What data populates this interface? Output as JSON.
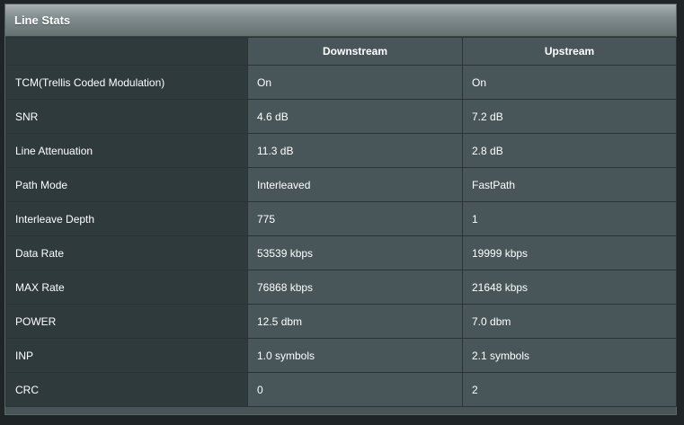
{
  "panel": {
    "title": "Line Stats"
  },
  "table": {
    "columns": [
      "",
      "Downstream",
      "Upstream"
    ],
    "rows": [
      {
        "label": "TCM(Trellis Coded Modulation)",
        "downstream": "On",
        "upstream": "On"
      },
      {
        "label": "SNR",
        "downstream": "4.6 dB",
        "upstream": "7.2 dB"
      },
      {
        "label": "Line Attenuation",
        "downstream": "11.3 dB",
        "upstream": "2.8 dB"
      },
      {
        "label": "Path Mode",
        "downstream": "Interleaved",
        "upstream": "FastPath"
      },
      {
        "label": "Interleave Depth",
        "downstream": "775",
        "upstream": "1"
      },
      {
        "label": "Data Rate",
        "downstream": "53539 kbps",
        "upstream": "19999 kbps"
      },
      {
        "label": "MAX Rate",
        "downstream": "76868 kbps",
        "upstream": "21648 kbps"
      },
      {
        "label": "POWER",
        "downstream": "12.5 dbm",
        "upstream": "7.0 dbm"
      },
      {
        "label": "INP",
        "downstream": "1.0 symbols",
        "upstream": "2.1 symbols"
      },
      {
        "label": "CRC",
        "downstream": "0",
        "upstream": "2"
      }
    ]
  },
  "colors": {
    "header_bar": "#7f8a8d",
    "label_cell": "#2f3a3c",
    "value_cell": "#485659",
    "grid_line": "#2b3335",
    "text": "#ffffff"
  }
}
